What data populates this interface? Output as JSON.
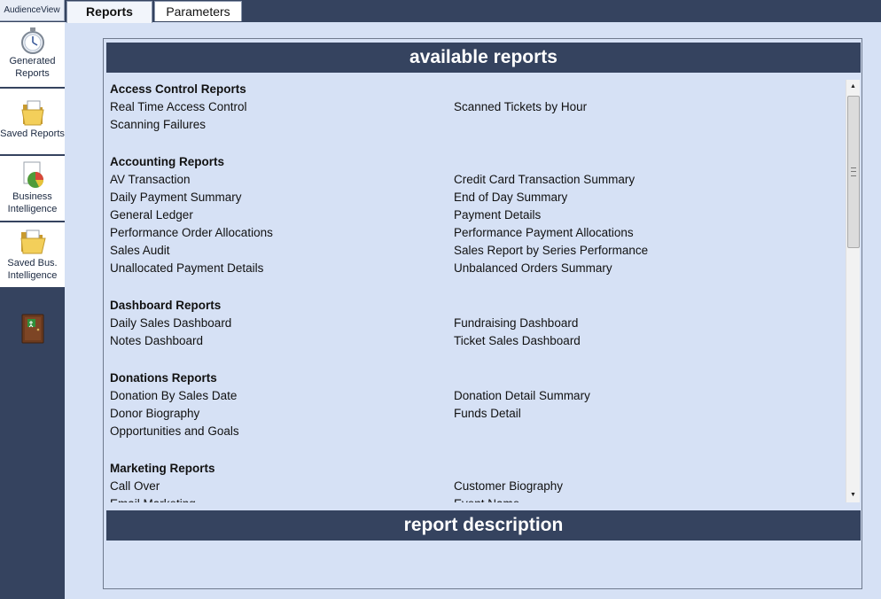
{
  "app": {
    "brand": "AudienceView"
  },
  "tabs": [
    {
      "label": "Reports",
      "active": true
    },
    {
      "label": "Parameters",
      "active": false
    }
  ],
  "sidebar": {
    "items": [
      {
        "label_line1": "Generated",
        "label_line2": "Reports",
        "icon": "clock-icon"
      },
      {
        "label_line1": "Saved Reports",
        "label_line2": "",
        "icon": "folder-document-icon"
      },
      {
        "label_line1": "Business",
        "label_line2": "Intelligence",
        "icon": "pie-chart-document-icon"
      },
      {
        "label_line1": "Saved Bus.",
        "label_line2": "Intelligence",
        "icon": "folder-open-icon"
      }
    ],
    "exit_icon": "exit-door-icon"
  },
  "panel": {
    "available_title": "available reports",
    "description_title": "report description",
    "description_text": ""
  },
  "report_groups": [
    {
      "title": "Access Control Reports",
      "reports": [
        "Real Time Access Control",
        "Scanned Tickets by Hour",
        "Scanning Failures"
      ]
    },
    {
      "title": "Accounting Reports",
      "reports": [
        "AV Transaction",
        "Credit Card Transaction Summary",
        "Daily Payment Summary",
        "End of Day Summary",
        "General Ledger",
        "Payment Details",
        "Performance Order Allocations",
        "Performance Payment Allocations",
        "Sales Audit",
        "Sales Report by Series Performance",
        "Unallocated Payment Details",
        "Unbalanced Orders Summary"
      ]
    },
    {
      "title": "Dashboard Reports",
      "reports": [
        "Daily Sales Dashboard",
        "Fundraising Dashboard",
        "Notes Dashboard",
        "Ticket Sales Dashboard"
      ]
    },
    {
      "title": "Donations Reports",
      "reports": [
        "Donation By Sales Date",
        "Donation Detail Summary",
        "Donor Biography",
        "Funds Detail",
        "Opportunities and Goals"
      ]
    },
    {
      "title": "Marketing Reports",
      "reports": [
        "Call Over",
        "Customer Biography",
        "Email Marketing",
        "Event Name"
      ]
    }
  ],
  "colors": {
    "nav_dark": "#35435f",
    "background": "#d6e1f5",
    "header_text": "#ffffff"
  }
}
